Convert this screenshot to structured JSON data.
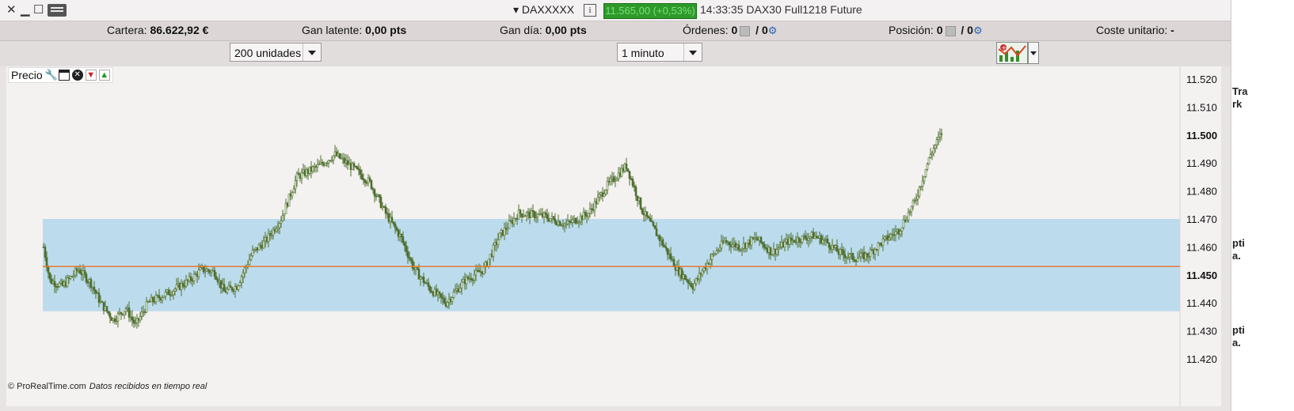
{
  "titlebar": {
    "instrument": "▾ DAXXXXX",
    "price_change": "11.565,00 (+0,53%)",
    "time_desc": "14:33:35 DAX30 Full1218 Future",
    "colors": {
      "price_box": "#2e9a2a"
    }
  },
  "stats": {
    "cartera_label": "Cartera:",
    "cartera_value": "86.622,92 €",
    "gan_latente_label": "Gan latente:",
    "gan_latente_value": "0,00 pts",
    "gan_dia_label": "Gan día:",
    "gan_dia_value": "0,00 pts",
    "ordenes_label": "Órdenes:",
    "ordenes_value": "0",
    "ordenes_value2": "/ 0",
    "posicion_label": "Posición:",
    "posicion_value": "0",
    "posicion_value2": "/ 0",
    "coste_label": "Coste unitario:",
    "coste_value": "-"
  },
  "toolbar": {
    "units_select": "200 unidades",
    "interval_select": "1 minuto"
  },
  "chart": {
    "panel_label": "Precio",
    "footer_brand": "© ProRealTime.com",
    "footer_note": "Datos recibidos en tiempo real",
    "y_ticks": [
      "11.520",
      "11.510",
      "11.500",
      "11.490",
      "11.480",
      "11.470",
      "11.460",
      "11.450",
      "11.440",
      "11.430",
      "11.420"
    ],
    "y_bold": [
      "11.500",
      "11.450"
    ],
    "range_low": 11437,
    "range_high": 11470,
    "horizontal_line": 11453,
    "colors": {
      "band": "#bcdcee",
      "line": "#e7782e",
      "candle": "#4f6e2f",
      "candle_up": "#eef6e4"
    }
  },
  "right_edge_text": [
    "Tra",
    "rk",
    "pti",
    "a.",
    "pti",
    "a."
  ]
}
